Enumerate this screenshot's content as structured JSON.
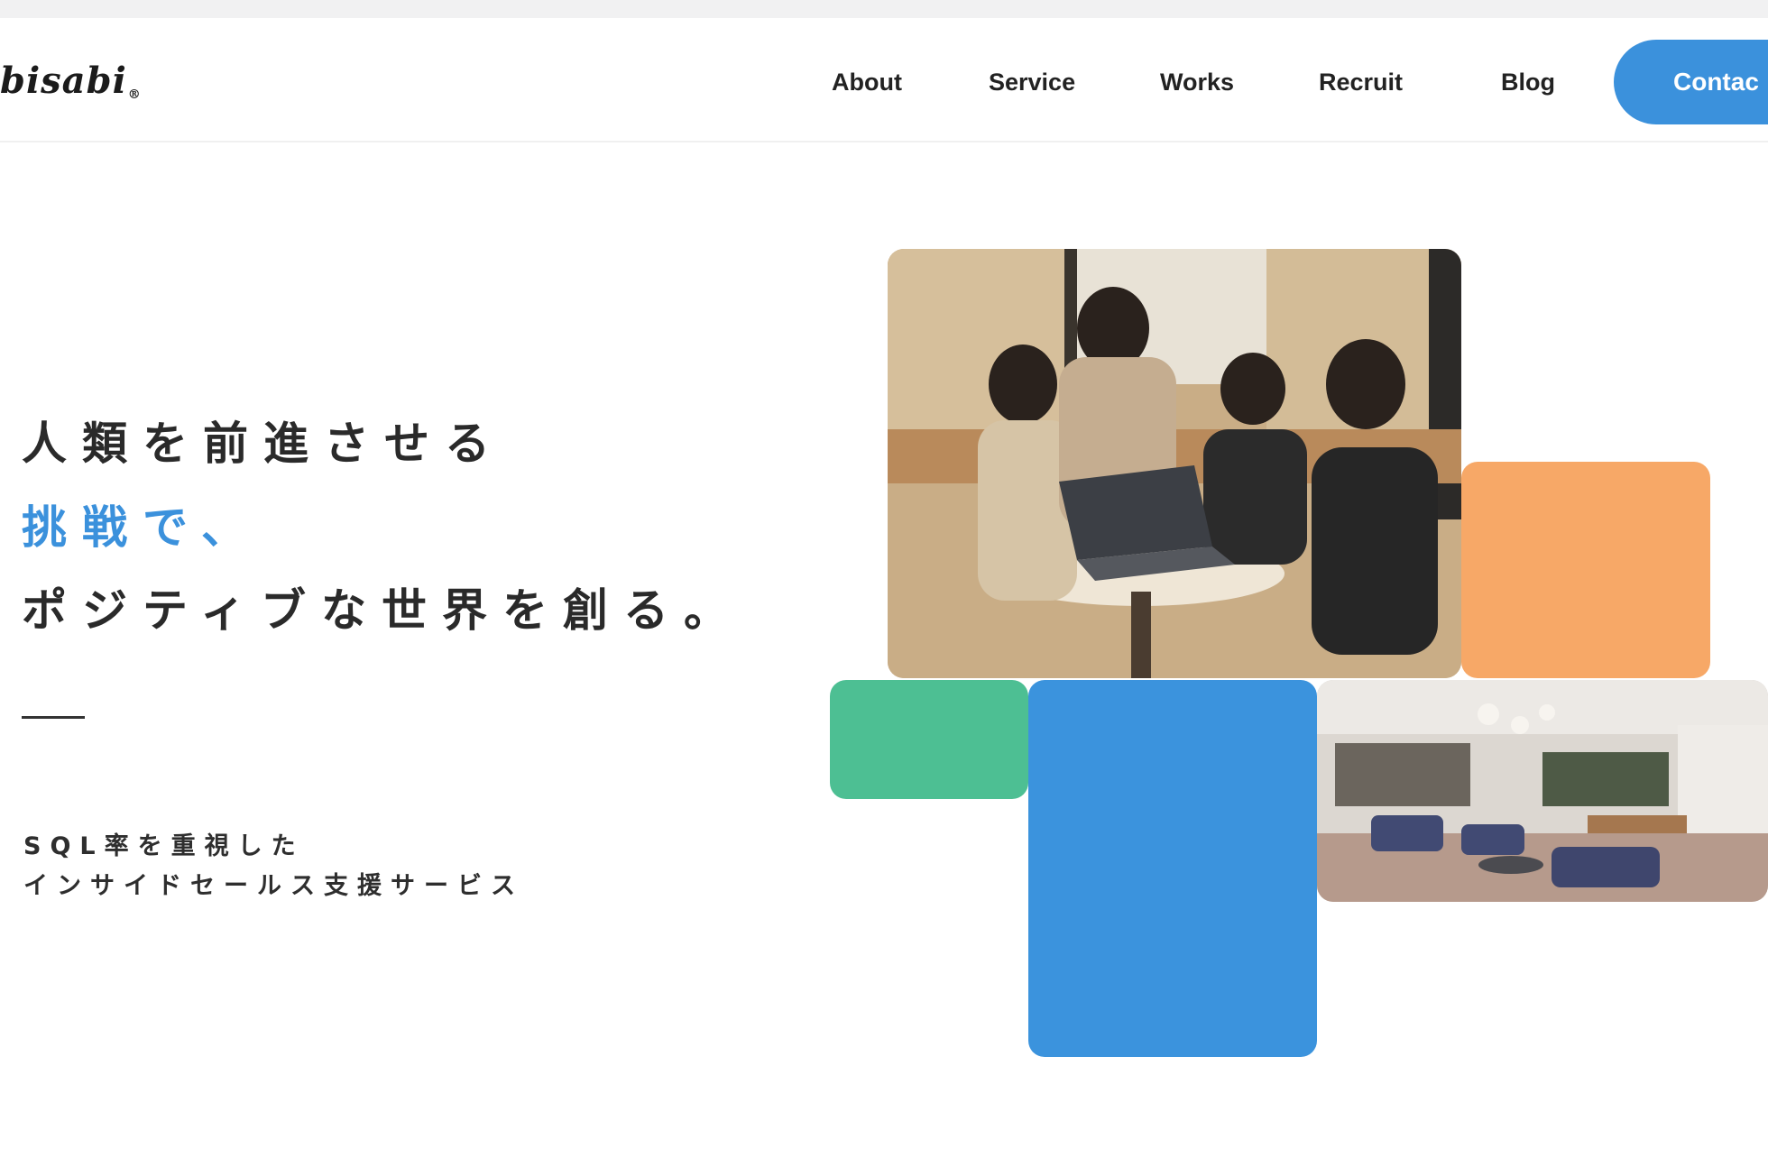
{
  "header": {
    "logo": {
      "text": "bisabi",
      "mark": "®"
    },
    "nav": [
      {
        "label": "About"
      },
      {
        "label": "Service"
      },
      {
        "label": "Works"
      },
      {
        "label": "Recruit"
      },
      {
        "label": "Blog"
      }
    ],
    "contact_label": "Contac"
  },
  "hero": {
    "line1": "人類を前進させる",
    "line2": "挑戦で、",
    "line3": "ポジティブな世界を創る。",
    "sub_line1": "SQL率を重視した",
    "sub_line2": "インサイドセールス支援サービス"
  },
  "colors": {
    "accent_blue": "#3b91dc",
    "tile_orange": "#f7a867",
    "tile_green": "#4dbf93",
    "tile_blue": "#3b93dd"
  }
}
